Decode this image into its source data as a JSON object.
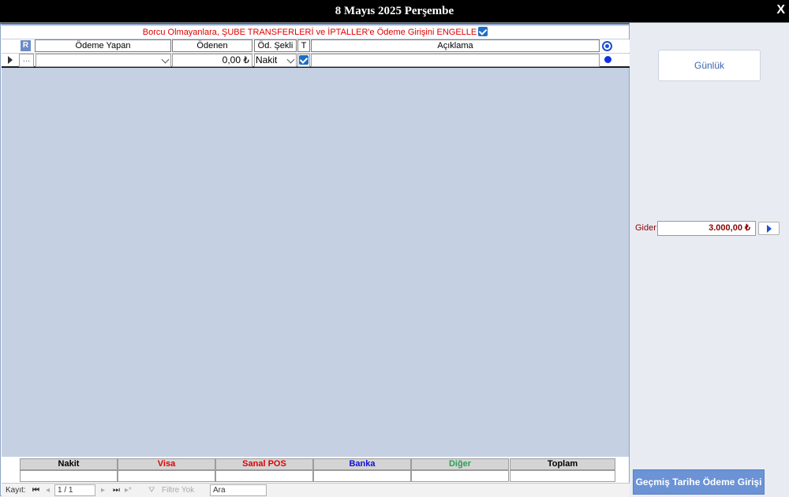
{
  "window": {
    "title": "8 Mayıs 2025 Perşembe",
    "close_label": "X"
  },
  "warning": {
    "text": "Borcu Olmayanlara, ŞUBE TRANSFERLERİ ve İPTALLER'e Ödeme Girişini ENGELLE",
    "checked": true
  },
  "columns": {
    "r_badge": "R",
    "payer": "Ödeme Yapan",
    "paid": "Ödenen",
    "method": "Öd. Şekli",
    "t": "T",
    "description": "Açıklama"
  },
  "row": {
    "more": "...",
    "payer": "",
    "paid": "0,00 ₺",
    "method": "Nakit",
    "t_checked": true,
    "description": ""
  },
  "totals": {
    "headers": [
      {
        "label": "Nakit",
        "color": "#000000"
      },
      {
        "label": "Visa",
        "color": "#e00000"
      },
      {
        "label": "Sanal POS",
        "color": "#e00000"
      },
      {
        "label": "Banka",
        "color": "#1010d0"
      },
      {
        "label": "Diğer",
        "color": "#2e9e55"
      },
      {
        "label": "Toplam",
        "color": "#000000"
      }
    ]
  },
  "navigation": {
    "record_label": "Kayıt:",
    "position": "1 / 1",
    "filter": "Filtre Yok",
    "search_placeholder": "Ara"
  },
  "side": {
    "daily_button": "Günlük",
    "expense_label": "Gider",
    "expense_value": "3.000,00 ₺",
    "past_date_button": "Geçmiş Tarihe Ödeme Girişi"
  }
}
